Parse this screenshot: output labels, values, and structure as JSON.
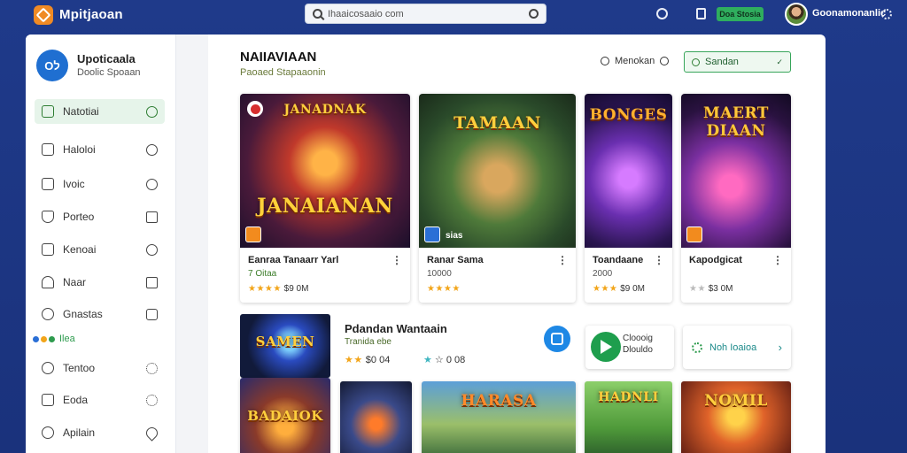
{
  "topbar": {
    "app_title": "Mpitjaoan",
    "search_value": "Ihaaicosaaio com",
    "store_label": "Doa Stosia",
    "user_name": "Goonamonanlic"
  },
  "sidebar": {
    "profile": {
      "initials": "Oל",
      "name": "Upoticaala",
      "subtitle": "Doolic Spoaan"
    },
    "items": [
      {
        "label": "Natotiai",
        "active": true
      },
      {
        "label": "Haloloi",
        "active": false
      },
      {
        "label": "Ivoic",
        "active": false
      },
      {
        "label": "Porteo",
        "active": false
      },
      {
        "label": "Kenoai",
        "active": false
      },
      {
        "label": "Naar",
        "active": false
      },
      {
        "label": "Gnastas",
        "active": false
      },
      {
        "label": "Tentoo",
        "active": false
      },
      {
        "label": "Eoda",
        "active": false
      },
      {
        "label": "Apilain",
        "active": false
      }
    ],
    "dots_label": "Ilea",
    "dot_colors": [
      "#2a6fd6",
      "#f2a51a",
      "#2e9b4e"
    ]
  },
  "content": {
    "section_title": "NAIIAVIAAN",
    "section_subtitle": "Paoaed Stapaaonin",
    "menu_label": "Menokan",
    "filter_label": "Sandan",
    "games": [
      {
        "art_title": "JANAIANAN",
        "art_top": "JANADNAK",
        "title": "Eanraa Tanaarr Yarl",
        "publisher": "7 Oitaa",
        "price": "$9 0M",
        "stars": "★★★★"
      },
      {
        "art_title": "TAMAAN",
        "art_top": "",
        "title": "Ranar Sama",
        "publisher": "10000",
        "price": "",
        "stars": "★★★★",
        "overlay": "sias"
      },
      {
        "art_title": "BONGES",
        "art_top": "",
        "title": "Toandaane",
        "publisher": "2000",
        "price": "$9 0M",
        "stars": "★★★"
      },
      {
        "art_title": "MAERT DIAAN",
        "art_top": "",
        "title": "Kapodgicat",
        "publisher": "",
        "price": "$3 0M",
        "stars": "★★"
      }
    ],
    "feature": {
      "thumb_title": "SAMEN",
      "title": "Pdandan Wantaain",
      "publisher": "Tranida ebe",
      "rating1": "$0 04",
      "rating2": "0 08",
      "gplay_label": "Cloooig Dlouldo",
      "cta_label": "Noh Ioaioa"
    },
    "bottom_tiles": [
      {
        "text": "BADAIOK"
      },
      {
        "text": ""
      },
      {
        "text": "HARASA"
      },
      {
        "text": "HADNLI"
      },
      {
        "text": "NOMIL"
      }
    ]
  },
  "colors": {
    "background": "#1f3a8a",
    "accent_green": "#2e9b4e",
    "store_green": "#2fae5e",
    "share_blue": "#1e88e5",
    "star": "#f2a51a"
  }
}
